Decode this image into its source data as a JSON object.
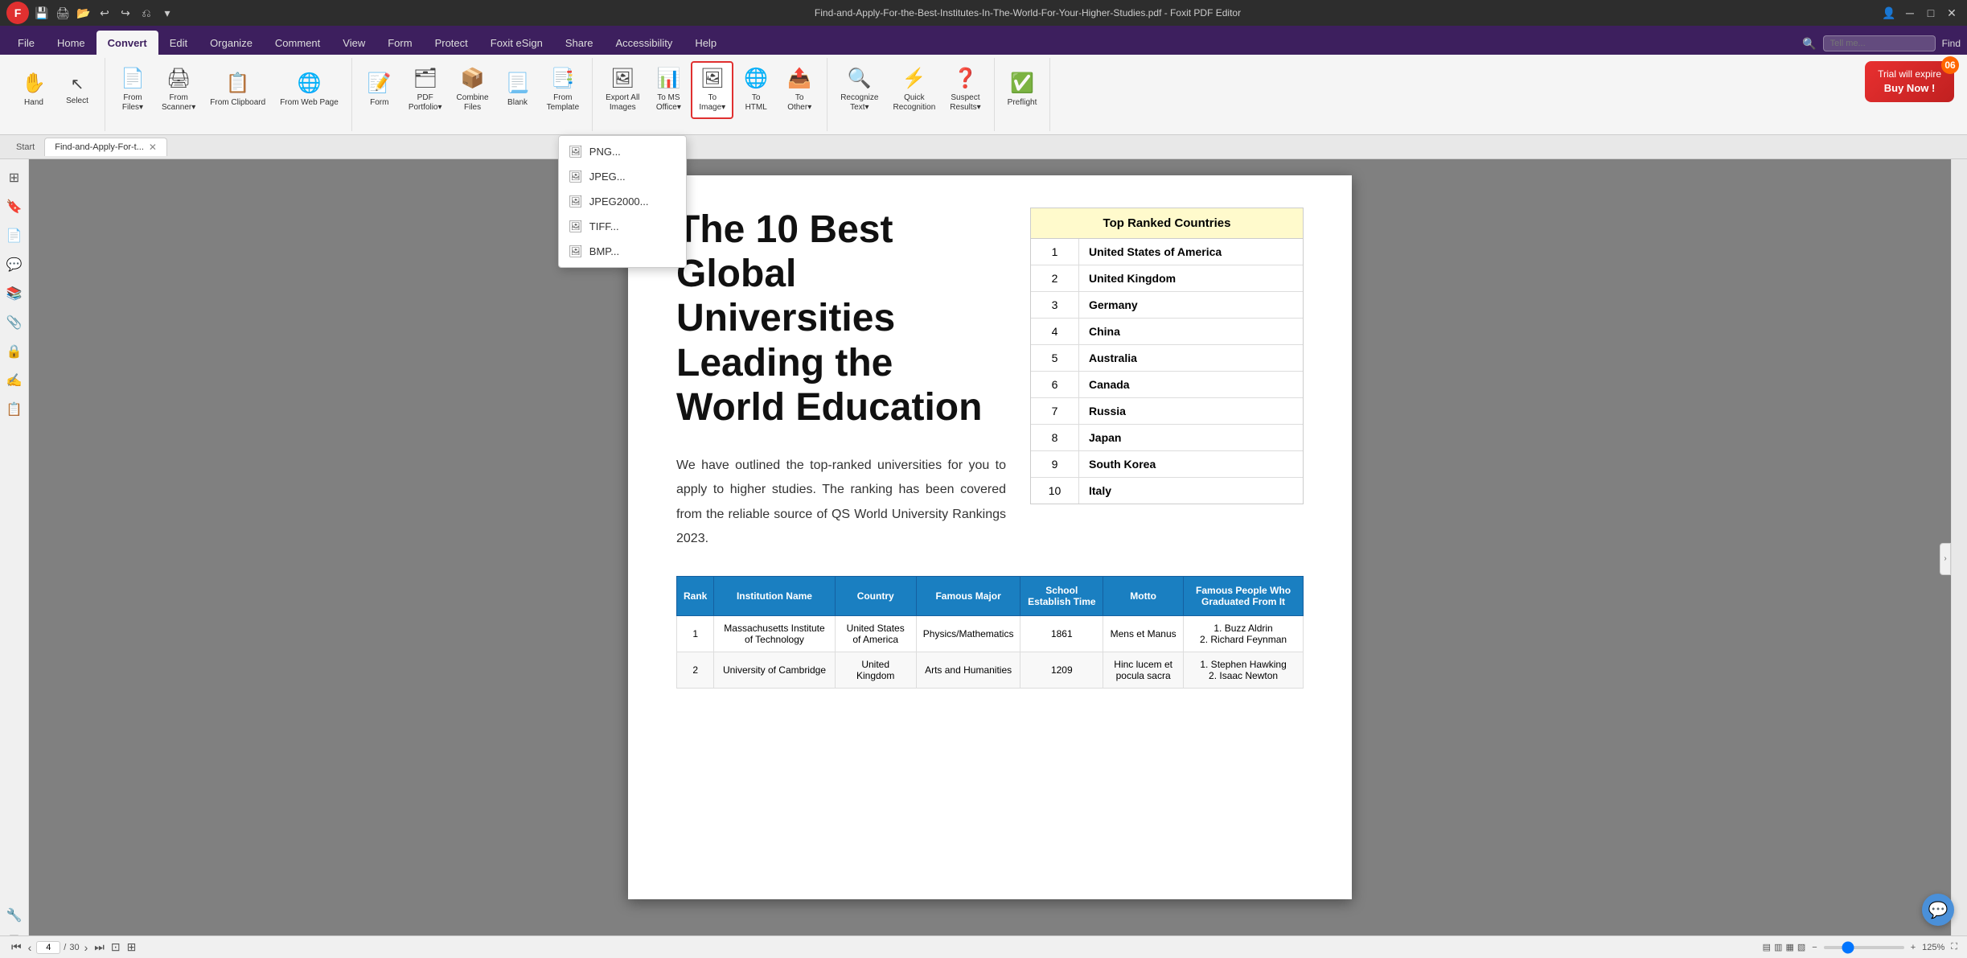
{
  "titleBar": {
    "title": "Find-and-Apply-For-the-Best-Institutes-In-The-World-For-Your-Higher-Studies.pdf - Foxit PDF Editor",
    "closeLabel": "✕",
    "minimizeLabel": "─",
    "maximizeLabel": "□"
  },
  "quickAccess": {
    "icons": [
      "save",
      "print",
      "open",
      "undo",
      "redo",
      "undo-arrow",
      "dropdown"
    ]
  },
  "ribbonTabs": [
    {
      "id": "file",
      "label": "File"
    },
    {
      "id": "home",
      "label": "Home"
    },
    {
      "id": "convert",
      "label": "Convert",
      "active": true
    },
    {
      "id": "edit",
      "label": "Edit"
    },
    {
      "id": "organize",
      "label": "Organize"
    },
    {
      "id": "comment",
      "label": "Comment"
    },
    {
      "id": "view",
      "label": "View"
    },
    {
      "id": "form",
      "label": "Form"
    },
    {
      "id": "protect",
      "label": "Protect"
    },
    {
      "id": "foxiteSign",
      "label": "Foxit eSign"
    },
    {
      "id": "share",
      "label": "Share"
    },
    {
      "id": "accessibility",
      "label": "Accessibility"
    },
    {
      "id": "help",
      "label": "Help"
    }
  ],
  "ribbon": {
    "groups": [
      {
        "id": "hand-select",
        "buttons": [
          {
            "id": "hand",
            "icon": "✋",
            "label": "Hand"
          },
          {
            "id": "select",
            "icon": "↖",
            "label": "Select"
          }
        ],
        "label": ""
      },
      {
        "id": "from-group",
        "buttons": [
          {
            "id": "from-files",
            "icon": "📄",
            "label": "From\nFiles"
          },
          {
            "id": "from-scanner",
            "icon": "🖨",
            "label": "From\nScanner"
          },
          {
            "id": "from-clipboard",
            "icon": "📋",
            "label": "From\nClipboard"
          },
          {
            "id": "from-webpage",
            "icon": "🌐",
            "label": "From\nWeb Page"
          }
        ],
        "label": ""
      },
      {
        "id": "form-group",
        "buttons": [
          {
            "id": "form-btn",
            "icon": "📝",
            "label": "Form"
          },
          {
            "id": "pdf-portfolio",
            "icon": "🗂",
            "label": "PDF\nPortfolio"
          },
          {
            "id": "combine-files",
            "icon": "📦",
            "label": "Combine\nFiles"
          },
          {
            "id": "blank",
            "icon": "📃",
            "label": "Blank"
          },
          {
            "id": "from-template",
            "icon": "📑",
            "label": "From\nTemplate"
          }
        ],
        "label": ""
      },
      {
        "id": "export-group",
        "buttons": [
          {
            "id": "export-all-images",
            "icon": "🖼",
            "label": "Export All\nImages"
          },
          {
            "id": "to-ms-office",
            "icon": "📊",
            "label": "To MS\nOffice"
          },
          {
            "id": "to-image",
            "icon": "🖼",
            "label": "To\nImage▾",
            "highlighted": true
          },
          {
            "id": "to-html",
            "icon": "🌐",
            "label": "To\nHTML"
          },
          {
            "id": "to-other",
            "icon": "📤",
            "label": "To\nOther▾"
          }
        ],
        "label": ""
      },
      {
        "id": "ocr-group",
        "buttons": [
          {
            "id": "recognize-text",
            "icon": "🔍",
            "label": "Recognize\nText"
          },
          {
            "id": "quick-recognition",
            "icon": "⚡",
            "label": "Quick\nRecognition"
          },
          {
            "id": "suspect-results",
            "icon": "❓",
            "label": "Suspect\nResults"
          }
        ],
        "label": ""
      },
      {
        "id": "preflight-group",
        "buttons": [
          {
            "id": "preflight",
            "icon": "✅",
            "label": "Preflight"
          }
        ],
        "label": ""
      }
    ]
  },
  "trial": {
    "line1": "Trial will expire",
    "line2": "Buy Now !",
    "badge": "06"
  },
  "tabs": [
    {
      "id": "start",
      "label": "Start"
    },
    {
      "id": "doc",
      "label": "Find-and-Apply-For-t...",
      "active": true,
      "closeable": true
    }
  ],
  "document": {
    "title": "The 10 Best Global Universities Leading the World Education",
    "intro": "We have outlined the top-ranked universities for you to apply to higher studies. The ranking has been covered from the reliable source of QS World University Rankings 2023.",
    "rankedTable": {
      "header": "Top Ranked Countries",
      "rows": [
        {
          "rank": "1",
          "country": "United States of America"
        },
        {
          "rank": "2",
          "country": "United Kingdom"
        },
        {
          "rank": "3",
          "country": "Germany"
        },
        {
          "rank": "4",
          "country": "China"
        },
        {
          "rank": "5",
          "country": "Australia"
        },
        {
          "rank": "6",
          "country": "Canada"
        },
        {
          "rank": "7",
          "country": "Russia"
        },
        {
          "rank": "8",
          "country": "Japan"
        },
        {
          "rank": "9",
          "country": "South Korea"
        },
        {
          "rank": "10",
          "country": "Italy"
        }
      ]
    },
    "dataTable": {
      "headers": [
        "Rank",
        "Institution Name",
        "Country",
        "Famous Major",
        "School Establish Time",
        "Motto",
        "Famous People Who Graduated From It"
      ],
      "rows": [
        {
          "rank": "1",
          "institution": "Massachusetts Institute of Technology",
          "country": "United States of America",
          "major": "Physics/Mathematics",
          "established": "1861",
          "motto": "Mens et Manus",
          "famous": "1. Buzz Aldrin\n2. Richard Feynman"
        },
        {
          "rank": "2",
          "institution": "University of Cambridge",
          "country": "United Kingdom",
          "major": "Arts and Humanities",
          "established": "1209",
          "motto": "Hinc lucem et pocula sacra",
          "famous": "1. Stephen Hawking\n2. Isaac Newton"
        }
      ]
    }
  },
  "dropdown": {
    "items": [
      {
        "id": "png",
        "icon": "🖼",
        "label": "PNG..."
      },
      {
        "id": "jpeg",
        "icon": "🖼",
        "label": "JPEG..."
      },
      {
        "id": "jpeg2000",
        "icon": "🖼",
        "label": "JPEG2000..."
      },
      {
        "id": "tiff",
        "icon": "🖼",
        "label": "TIFF..."
      },
      {
        "id": "bmp",
        "icon": "🖼",
        "label": "BMP..."
      }
    ]
  },
  "bottomBar": {
    "currentPage": "4",
    "totalPages": "30",
    "zoomLevel": "125%",
    "navButtons": [
      "«",
      "‹",
      "›",
      "»"
    ]
  },
  "searchPlaceholder": "Tell me..."
}
